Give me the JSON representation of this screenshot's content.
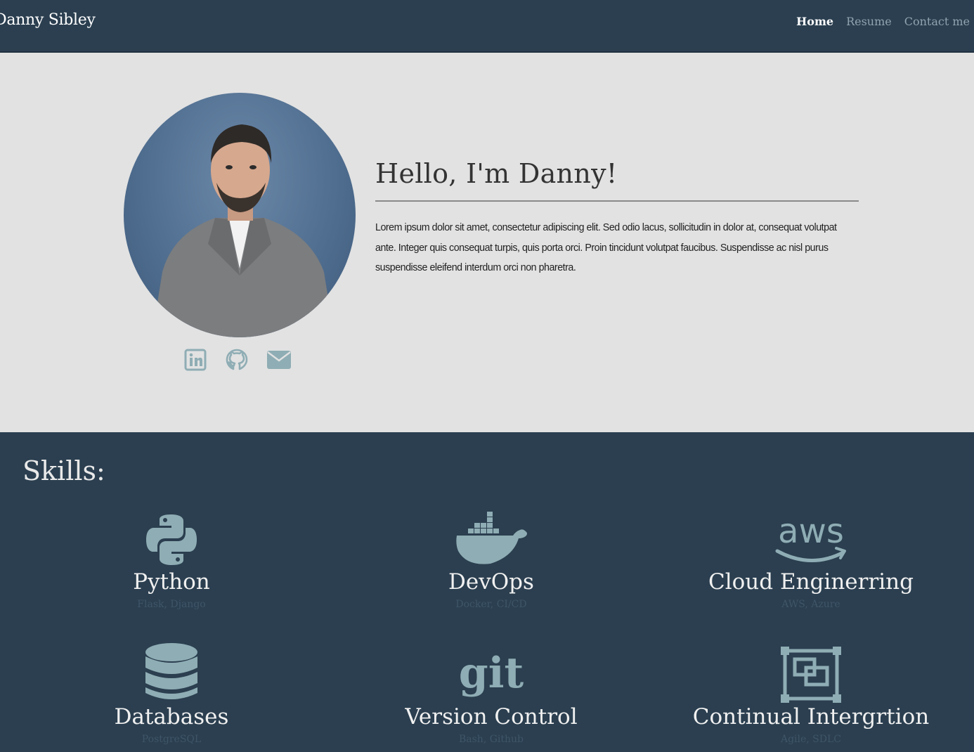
{
  "nav": {
    "brand": "Danny Sibley",
    "links": [
      {
        "label": "Home",
        "active": true
      },
      {
        "label": "Resume",
        "active": false
      },
      {
        "label": "Contact me",
        "active": false
      }
    ]
  },
  "hero": {
    "heading": "Hello, I'm Danny!",
    "intro": "Lorem ipsum dolor sit amet, consectetur adipiscing elit. Sed odio lacus, sollicitudin in dolor at, consequat volutpat ante. Integer quis consequat turpis, quis porta orci. Proin tincidunt volutpat faucibus. Suspendisse ac nisl purus suspendisse eleifend interdum orci non pharetra.",
    "social_icons": [
      "linkedin-icon",
      "github-icon",
      "envelope-icon"
    ]
  },
  "skills": {
    "heading": "Skills:",
    "items": [
      {
        "name": "Python",
        "sub": "Flask, Django",
        "icon": "python-icon"
      },
      {
        "name": "DevOps",
        "sub": "Docker, CI/CD",
        "icon": "docker-icon"
      },
      {
        "name": "Cloud Enginerring",
        "sub": "AWS, Azure",
        "icon": "aws-icon"
      },
      {
        "name": "Databases",
        "sub": "PostgreSQL",
        "icon": "database-icon"
      },
      {
        "name": "Version Control",
        "sub": "Bash, Github",
        "icon": "git-icon"
      },
      {
        "name": "Continual Intergrtion",
        "sub": "Agile, SDLC",
        "icon": "integration-icon"
      }
    ]
  },
  "colors": {
    "navbar": "#2b3f50",
    "hero_bg": "#e2e2e2",
    "icon": "#8fadb4"
  }
}
